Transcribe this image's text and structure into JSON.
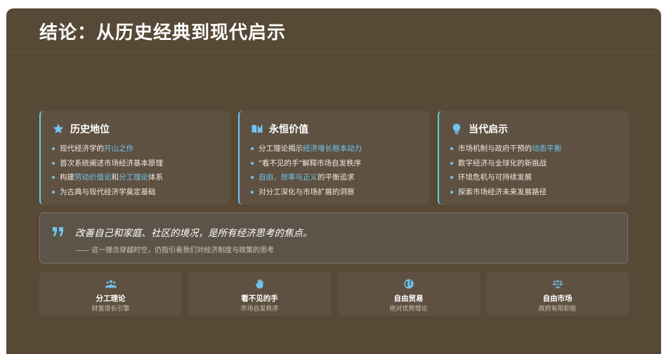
{
  "title": "结论：从历史经典到现代启示",
  "colors": {
    "accent": "#6ec6f0",
    "background": "#574936",
    "card": "#5f5142"
  },
  "cards": [
    {
      "icon": "star-icon",
      "title": "历史地位",
      "items": [
        [
          {
            "t": "现代经济学的"
          },
          {
            "t": "开山之作",
            "hl": true
          }
        ],
        [
          {
            "t": "首次系统阐述市场经济基本原理"
          }
        ],
        [
          {
            "t": "构建"
          },
          {
            "t": "劳动价值论",
            "hl": true
          },
          {
            "t": "和"
          },
          {
            "t": "分工理论",
            "hl": true
          },
          {
            "t": "体系"
          }
        ],
        [
          {
            "t": "为古典与现代经济学奠定基础"
          }
        ]
      ]
    },
    {
      "icon": "open-book-icon",
      "title": "永恒价值",
      "items": [
        [
          {
            "t": "分工理论揭示"
          },
          {
            "t": "经济增长根本动力",
            "hl": true
          }
        ],
        [
          {
            "t": "\"看不见的手\"解释市场自发秩序"
          }
        ],
        [
          {
            "t": "自由、效率与正义",
            "hl": true
          },
          {
            "t": "的平衡追求"
          }
        ],
        [
          {
            "t": "对分工深化与市场扩展的洞察"
          }
        ]
      ]
    },
    {
      "icon": "lightbulb-icon",
      "title": "当代启示",
      "items": [
        [
          {
            "t": "市场机制与政府干预的"
          },
          {
            "t": "动态平衡",
            "hl": true
          }
        ],
        [
          {
            "t": "数字经济与全球化的新挑战"
          }
        ],
        [
          {
            "t": "环境危机与可持续发展"
          }
        ],
        [
          {
            "t": "探索市场经济未来发展路径"
          }
        ]
      ]
    }
  ],
  "quote": {
    "icon": "quote-icon",
    "text": "改善自己和家庭、社区的境况，是所有经济思考的焦点。",
    "sub": "—— 这一理念穿越时空，仍指引着我们对经济制度与政策的思考"
  },
  "tiles": [
    {
      "icon": "people-group-icon",
      "title": "分工理论",
      "sub": "财富增长引擎"
    },
    {
      "icon": "hand-icon",
      "title": "看不见的手",
      "sub": "市场自发秩序"
    },
    {
      "icon": "globe-icon",
      "title": "自由贸易",
      "sub": "绝对优势理论"
    },
    {
      "icon": "balance-scale-icon",
      "title": "自由市场",
      "sub": "政府有限职能"
    }
  ]
}
